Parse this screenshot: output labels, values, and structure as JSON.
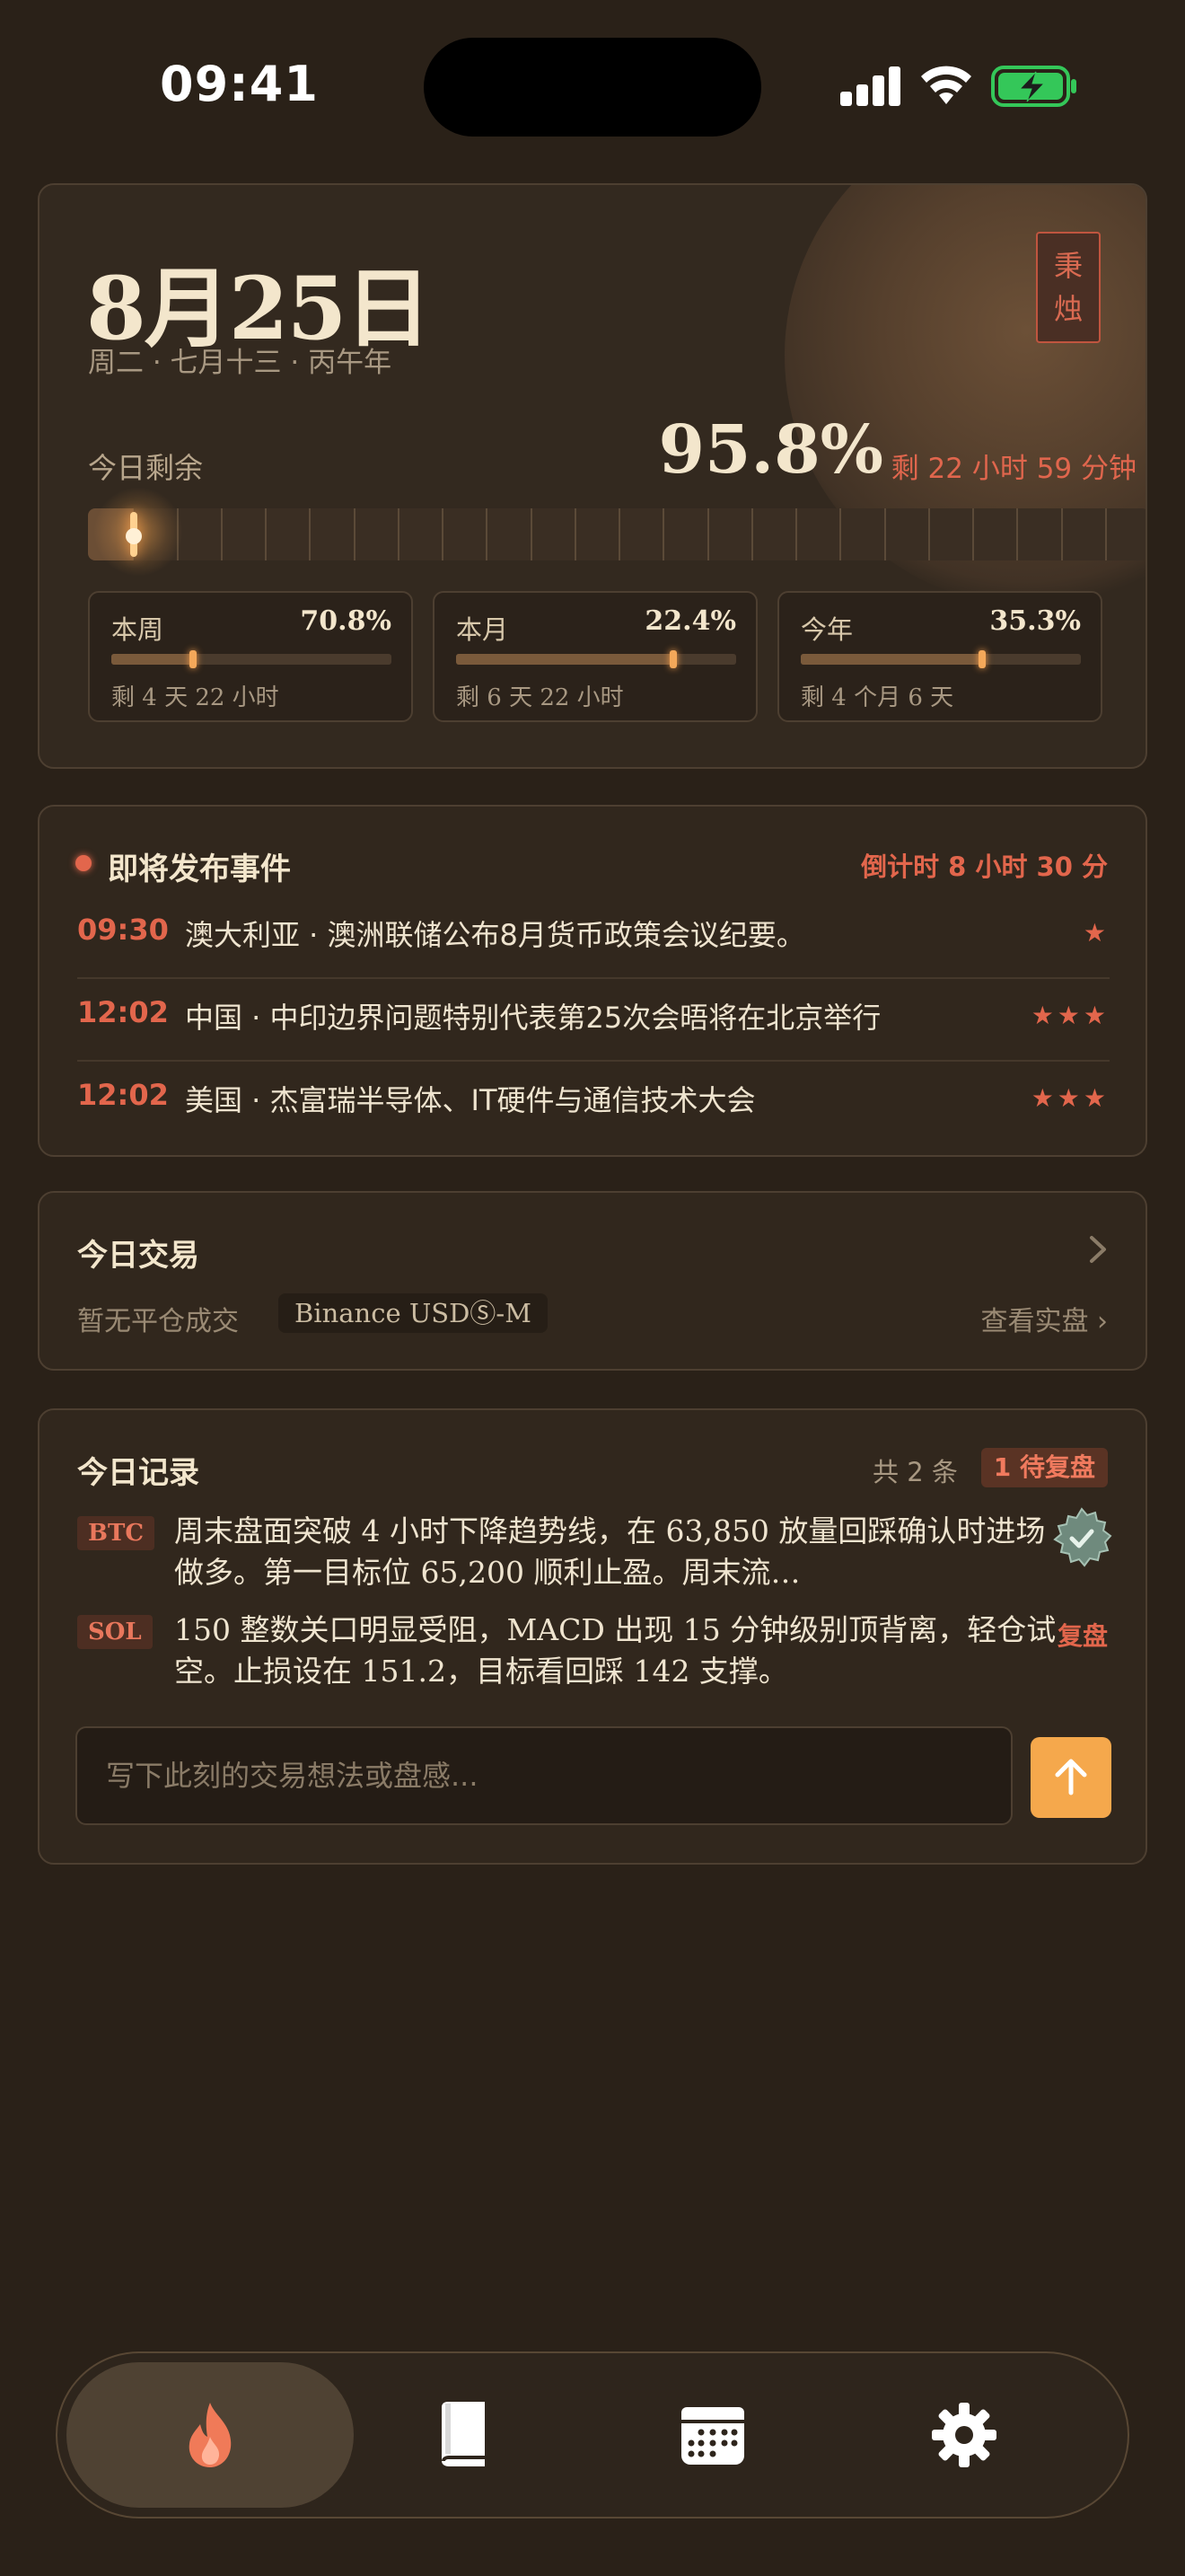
{
  "status_bar": {
    "time": "09:41"
  },
  "hero": {
    "date": "8月25日",
    "subtitle": "周二 · 七月十三 · 丙午年",
    "seal_line1": "秉",
    "seal_line2": "烛",
    "remain_label": "今日剩余",
    "remain_percent": "95.8%",
    "remain_left": "剩 22 小时 59 分钟",
    "day_progress": 0.042,
    "periods": [
      {
        "label": "本周",
        "percent": "70.8%",
        "sub": "剩 4 天 22 小时",
        "progress": 0.292
      },
      {
        "label": "本月",
        "percent": "22.4%",
        "sub": "剩 6 天 22 小时",
        "progress": 0.776
      },
      {
        "label": "今年",
        "percent": "35.3%",
        "sub": "剩 4 个月 6 天",
        "progress": 0.647
      }
    ]
  },
  "events": {
    "title": "即将发布事件",
    "countdown": "倒计时 8 小时 30 分",
    "items": [
      {
        "time": "09:30",
        "text": "澳大利亚 · 澳洲联储公布8月货币政策会议纪要。",
        "stars": "★"
      },
      {
        "time": "12:02",
        "text": "中国 · 中印边界问题特别代表第25次会晤将在北京举行",
        "stars": "★★★"
      },
      {
        "time": "12:02",
        "text": "美国 · 杰富瑞半导体、IT硬件与通信技术大会",
        "stars": "★★★"
      }
    ]
  },
  "trades": {
    "title": "今日交易",
    "empty_text": "暂无平仓成交",
    "exchange": "Binance USDⓈ-M",
    "link": "查看实盘 ›"
  },
  "records": {
    "title": "今日记录",
    "count": "共 2 条",
    "pending": "1 待复盘",
    "items": [
      {
        "tag": "BTC",
        "text": "周末盘面突破 4 小时下降趋势线，在 63,850 放量回踩确认时进场做多。第一目标位 65,200 顺利止盈。周末流…",
        "reviewed": true
      },
      {
        "tag": "SOL",
        "text": "150 整数关口明显受阻，MACD 出现 15 分钟级别顶背离，轻仓试空。止损设在 151.2，目标看回踩 142 支撑。",
        "action": "复盘"
      }
    ],
    "input_placeholder": "写下此刻的交易想法或盘感..."
  },
  "tabbar": {
    "tabs": [
      {
        "icon": "flame-icon",
        "active": true
      },
      {
        "icon": "book-icon",
        "active": false
      },
      {
        "icon": "calendar-icon",
        "active": false
      },
      {
        "icon": "gear-icon",
        "active": false
      }
    ]
  },
  "colors": {
    "background": "#2a2118",
    "card": "#31271d",
    "accent_red": "#e2664c",
    "accent_orange": "#f5a84c",
    "text_primary": "#f3e6cc"
  }
}
